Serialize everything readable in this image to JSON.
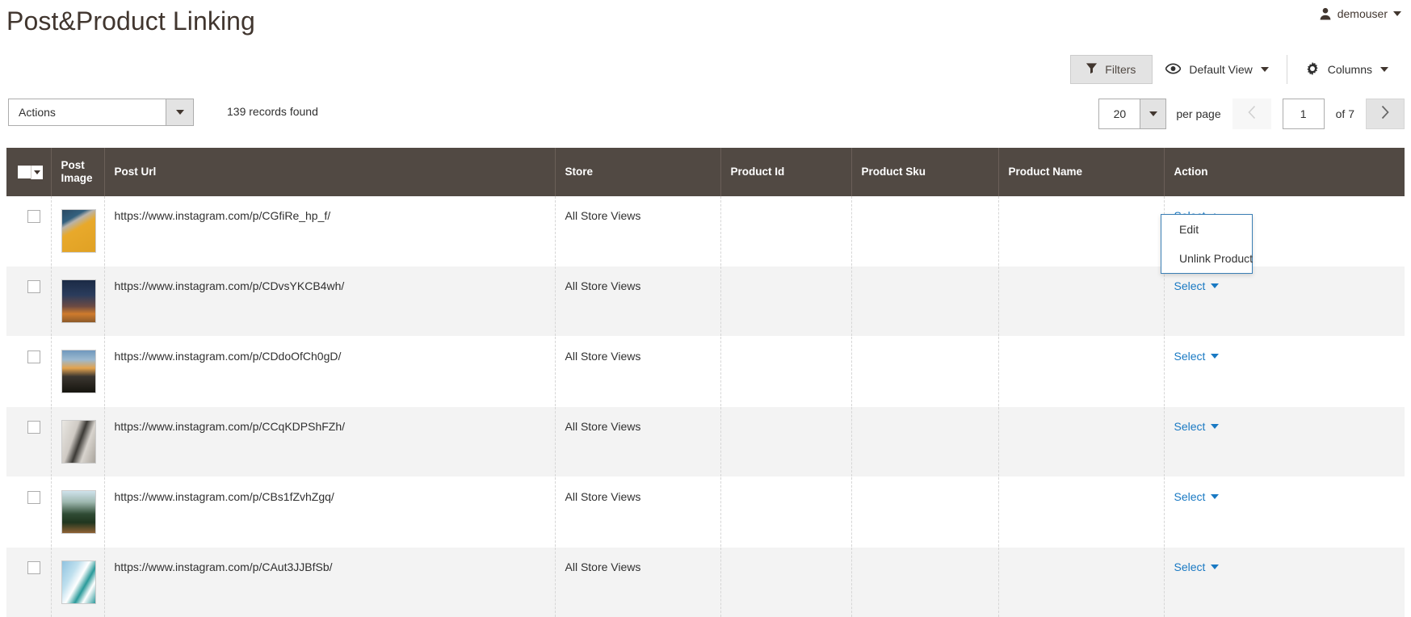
{
  "header": {
    "title": "Post&Product Linking",
    "user": {
      "name": "demouser",
      "icon": "user-avatar-icon"
    }
  },
  "toolbar": {
    "filters_label": "Filters",
    "view_label": "Default View",
    "columns_label": "Columns"
  },
  "grid_controls": {
    "actions_label": "Actions",
    "records_found": "139 records found",
    "per_page_value": "20",
    "per_page_label": "per page",
    "current_page": "1",
    "of_label": "of 7"
  },
  "table": {
    "columns": [
      "",
      "Post Image",
      "Post Url",
      "Store",
      "Product Id",
      "Product Sku",
      "Product Name",
      "Action"
    ],
    "action_link_label": "Select",
    "rows": [
      {
        "post_url": "https://www.instagram.com/p/CGfiRe_hp_f/",
        "store": "All Store Views",
        "product_id": "",
        "product_sku": "",
        "product_name": "",
        "thumb": "t1"
      },
      {
        "post_url": "https://www.instagram.com/p/CDvsYKCB4wh/",
        "store": "All Store Views",
        "product_id": "",
        "product_sku": "",
        "product_name": "",
        "thumb": "t2"
      },
      {
        "post_url": "https://www.instagram.com/p/CDdoOfCh0gD/",
        "store": "All Store Views",
        "product_id": "",
        "product_sku": "",
        "product_name": "",
        "thumb": "t3"
      },
      {
        "post_url": "https://www.instagram.com/p/CCqKDPShFZh/",
        "store": "All Store Views",
        "product_id": "",
        "product_sku": "",
        "product_name": "",
        "thumb": "t4"
      },
      {
        "post_url": "https://www.instagram.com/p/CBs1fZvhZgq/",
        "store": "All Store Views",
        "product_id": "",
        "product_sku": "",
        "product_name": "",
        "thumb": "t5"
      },
      {
        "post_url": "https://www.instagram.com/p/CAut3JJBfSb/",
        "store": "All Store Views",
        "product_id": "",
        "product_sku": "",
        "product_name": "",
        "thumb": "t6"
      }
    ]
  },
  "action_menu": {
    "open_row_index": 0,
    "items": [
      "Edit",
      "Unlink Product"
    ]
  },
  "colors": {
    "header_row": "#514943",
    "link": "#1979c3",
    "text": "#303030",
    "title": "#41362f",
    "stripe": "#f3f3f3"
  }
}
